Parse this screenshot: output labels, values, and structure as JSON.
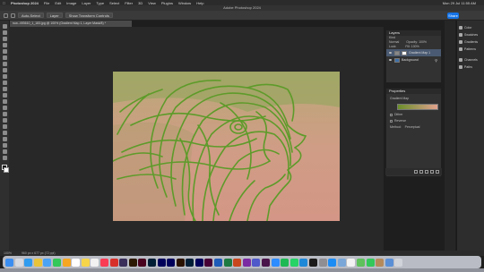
{
  "menubar": {
    "app": "Photoshop 2024",
    "items": [
      "File",
      "Edit",
      "Image",
      "Layer",
      "Type",
      "Select",
      "Filter",
      "3D",
      "View",
      "Plugins",
      "Window",
      "Help"
    ],
    "clock": "Mon 29 Jul 11:55 AM"
  },
  "window_title": "Adobe Photoshop 2024",
  "options": {
    "auto_select": "Auto-Select",
    "target": "Layer",
    "transform": "Show Transform Controls",
    "share": "Share"
  },
  "document_tab": "ruw-.493610_1_183.jpg @ 100% (Gradient Map 1, Layer Mask/8) *",
  "status": {
    "zoom": "100%",
    "dims": "960 px x 677 px (72 ppi)"
  },
  "layers_panel": {
    "title": "Layers",
    "search": "Kind",
    "blend": "Normal",
    "opacity_label": "Opacity: 100%",
    "lock_label": "Lock:",
    "fill_label": "Fill: 100%",
    "layers": [
      {
        "name": "Gradient Map 1",
        "selected": true
      },
      {
        "name": "Background",
        "selected": false
      }
    ]
  },
  "properties_panel": {
    "title": "Properties",
    "type_label": "Gradient Map",
    "options": [
      "Dither",
      "Reverse"
    ],
    "method_label": "Method:",
    "method_value": "Perceptual",
    "gradient_colors": [
      "#6a8f2a",
      "#e2a28e"
    ]
  },
  "right_dock": {
    "items": [
      "Color",
      "Swatches",
      "Gradients",
      "Patterns",
      "Channels",
      "Paths"
    ]
  },
  "colors": {
    "accent": "#1473e6",
    "artwork_stroke": "#5e9b2a"
  }
}
